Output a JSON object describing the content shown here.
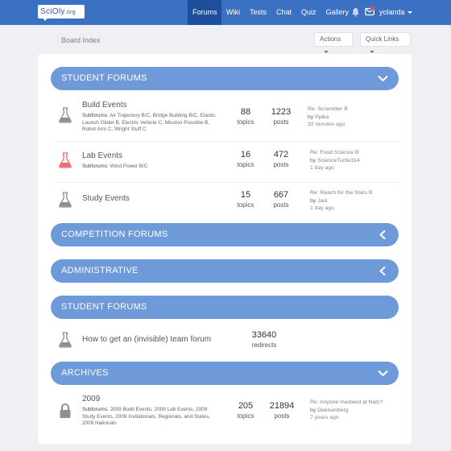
{
  "navbar": {
    "logo": {
      "main": "SciOly",
      "suffix": ".org"
    },
    "items": [
      "Forums",
      "Wiki",
      "Tests",
      "Chat",
      "Quiz",
      "Gallery"
    ],
    "active_item": "Forums",
    "username": "yolanda"
  },
  "breadcrumb": {
    "board_index": "Board Index"
  },
  "toolbar": {
    "actions": "Actions",
    "quick_links": "Quick Links"
  },
  "colors": {
    "navbar": "#3a71c3",
    "nav_active": "#1d4f9d",
    "category_header": "#6f9ad9",
    "lab_icon": "#e8706f",
    "notification": "#e84d4d"
  },
  "categories": {
    "student_1": {
      "title": "STUDENT FORUMS",
      "icon": "chevron-down-icon",
      "forums": [
        {
          "title": "Build Events",
          "icon": "flask-icon",
          "subforums_label": "Subforums:",
          "subforums": "Air Trajectory B/C, Bridge Building B/C, Elastic Launch Glider B, Electric Vehicle C, Mission Possible B, Robot Arm C, Wright Stuff C",
          "topics": "88",
          "topics_label": "topics",
          "posts": "1223",
          "posts_label": "posts",
          "last_post": {
            "title": "Re: Scrambler B",
            "by": "by",
            "user": "Ppika",
            "time": "32 minutes ago"
          }
        },
        {
          "title": "Lab Events",
          "icon": "flask-icon",
          "subforums_label": "Subforums:",
          "subforums": "Wind Power B/C",
          "topics": "16",
          "topics_label": "topics",
          "posts": "472",
          "posts_label": "posts",
          "last_post": {
            "title": "Re: Food Science B",
            "by": "by",
            "user": "ScienceTurtle314",
            "time": "1 day ago"
          }
        },
        {
          "title": "Study Events",
          "icon": "flask-icon",
          "topics": "15",
          "topics_label": "topics",
          "posts": "667",
          "posts_label": "posts",
          "last_post": {
            "title": "Re: Reach for the Stars B",
            "by": "by",
            "user": "Jaol",
            "time": "1 day ago"
          }
        }
      ]
    },
    "competition": {
      "title": "COMPETITION FORUMS",
      "icon": "chevron-left-icon"
    },
    "administrative": {
      "title": "ADMINISTRATIVE",
      "icon": "chevron-left-icon"
    },
    "student_2": {
      "title": "STUDENT FORUMS",
      "forums": [
        {
          "title": "How to get an (invisible) team forum",
          "icon": "flask-icon",
          "redirects": "33640",
          "redirects_label": "redirects"
        }
      ]
    },
    "archives": {
      "title": "ARCHIVES",
      "icon": "chevron-down-icon",
      "forums": [
        {
          "title": "2009",
          "icon": "lock-icon",
          "subforums_label": "Subforums:",
          "subforums": "2009 Build Events, 2009 Lab Events, 2009 Study Events, 2009 Invitationals, Regionals, and States, 2009 Nationals",
          "topics": "205",
          "topics_label": "topics",
          "posts": "21894",
          "posts_label": "posts",
          "last_post": {
            "title": "Re: Anyone medaled at Nats?",
            "by": "by",
            "user": "Deeisenberg",
            "time": "7 years ago"
          }
        }
      ]
    }
  }
}
